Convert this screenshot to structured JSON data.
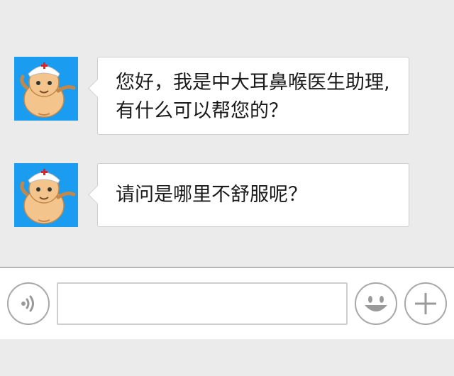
{
  "conversation": {
    "messages": [
      {
        "sender": "bot",
        "avatar_icon": "doctor-mascot-icon",
        "text": "您好，我是中大耳鼻喉医生助理,有什么可以帮您的？"
      },
      {
        "sender": "bot",
        "avatar_icon": "doctor-mascot-icon",
        "text": "请问是哪里不舒服呢？"
      }
    ]
  },
  "input_bar": {
    "voice_icon": "voice-icon",
    "text_value": "",
    "emoji_icon": "emoji-icon",
    "more_icon": "plus-icon"
  },
  "colors": {
    "background": "#ebebeb",
    "avatar_bg": "#1a9cf0",
    "bubble_bg": "#ffffff",
    "bubble_border": "#cfcfcf",
    "icon_gray": "#a8a8a8"
  }
}
